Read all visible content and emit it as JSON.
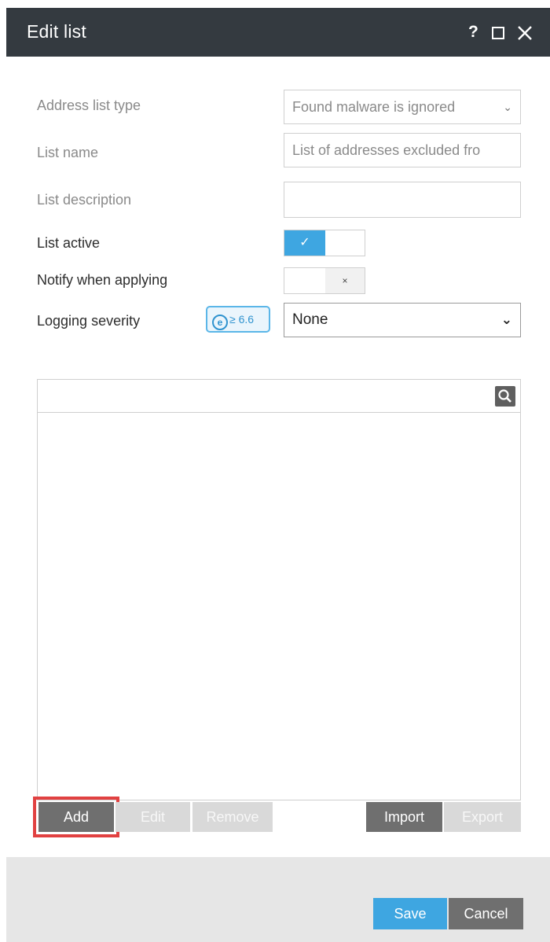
{
  "window": {
    "title": "Edit list",
    "help_glyph": "?"
  },
  "form": {
    "address_list_type": {
      "label": "Address list type",
      "value": "Found malware is ignored"
    },
    "list_name": {
      "label": "List name",
      "value": "List of addresses excluded fro"
    },
    "list_description": {
      "label": "List description",
      "value": ""
    },
    "list_active": {
      "label": "List active",
      "state": "on",
      "on_glyph": "✓"
    },
    "notify_when_applying": {
      "label": "Notify when applying",
      "state": "off",
      "off_glyph": "×"
    },
    "logging_severity": {
      "label": "Logging severity",
      "version_badge": {
        "icon_letter": "e",
        "text": "≥ 6.6"
      },
      "value": "None"
    }
  },
  "list_actions": {
    "add": "Add",
    "edit": "Edit",
    "remove": "Remove",
    "import": "Import",
    "export": "Export"
  },
  "footer": {
    "save": "Save",
    "cancel": "Cancel"
  },
  "colors": {
    "titlebar": "#343a40",
    "accent": "#3ea6e1",
    "dark_button": "#6f6f6f",
    "highlight": "#e14141"
  }
}
